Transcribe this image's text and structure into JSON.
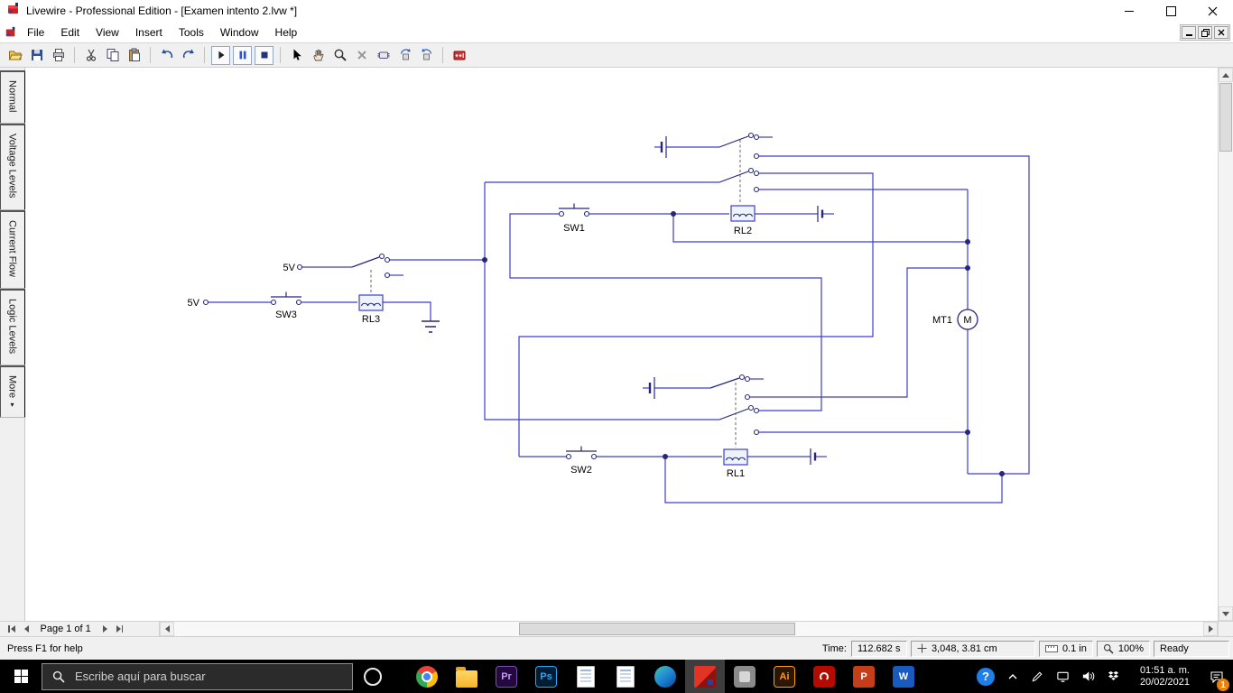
{
  "window": {
    "title": "Livewire - Professional Edition - [Examen intento 2.lvw *]",
    "controls": [
      "minimize",
      "maximize",
      "close"
    ]
  },
  "menubar": {
    "items": [
      {
        "label": "File",
        "name": "menu-file"
      },
      {
        "label": "Edit",
        "name": "menu-edit"
      },
      {
        "label": "View",
        "name": "menu-view"
      },
      {
        "label": "Insert",
        "name": "menu-insert"
      },
      {
        "label": "Tools",
        "name": "menu-tools"
      },
      {
        "label": "Window",
        "name": "menu-window"
      },
      {
        "label": "Help",
        "name": "menu-help"
      }
    ]
  },
  "toolbar": {
    "buttons": [
      "open-folder-icon",
      "save-floppy-icon",
      "print-icon",
      "cut-scissors-icon",
      "copy-icon",
      "paste-icon",
      "undo-icon",
      "redo-icon",
      "run-play-icon",
      "pause-icon",
      "stop-icon",
      "select-cursor-icon",
      "pan-hand-icon",
      "zoom-magnifier-icon",
      "delete-x-icon",
      "component-package-icon",
      "rotate-left-icon",
      "rotate-right-icon",
      "pcb-wizard-icon"
    ],
    "colors": {
      "run": "#222222",
      "pause": "#2a57c4",
      "stop": "#23327f",
      "pcb": "#cc3333"
    }
  },
  "sidebar": {
    "tabs": [
      {
        "label": "Normal",
        "name": "sidebar-tab-normal",
        "arrow": ""
      },
      {
        "label": "Voltage Levels",
        "name": "sidebar-tab-voltage-levels",
        "arrow": ""
      },
      {
        "label": "Current Flow",
        "name": "sidebar-tab-current-flow",
        "arrow": ""
      },
      {
        "label": "Logic Levels",
        "name": "sidebar-tab-logic-levels",
        "arrow": ""
      },
      {
        "label": "More",
        "name": "sidebar-tab-more",
        "arrow": "▾"
      }
    ]
  },
  "circuit": {
    "labels": {
      "sw1": "SW1",
      "sw2": "SW2",
      "sw3": "SW3",
      "rl1": "RL1",
      "rl2": "RL2",
      "rl3": "RL3",
      "mt1": "MT1",
      "motor": "M",
      "supply_a": "5V",
      "supply_b": "5V"
    },
    "wire_color": "#3d3dcc",
    "component_color": "#26267a"
  },
  "pager": {
    "page_label": "Page 1 of 1"
  },
  "statusbar": {
    "help": "Press F1 for help",
    "time_label": "Time:",
    "time_value": "112.682 s",
    "coordinates": "3,048, 3.81 cm",
    "grid_size": "0.1 in",
    "zoom": "100%",
    "state": "Ready",
    "icons": [
      "crosshair-icon",
      "ruler-icon",
      "magnifier-icon"
    ]
  },
  "taskbar": {
    "search_placeholder": "Escribe aquí para buscar",
    "apps": [
      {
        "name": "taskbar-chrome-icon",
        "cls": "ic-chrome",
        "wrap": "",
        "label": ""
      },
      {
        "name": "taskbar-file-explorer-icon",
        "cls": "ic-folder",
        "wrap": "",
        "label": ""
      },
      {
        "name": "taskbar-premiere-icon",
        "cls": "ic-pr",
        "wrap": "",
        "label": "Pr"
      },
      {
        "name": "taskbar-photoshop-icon",
        "cls": "ic-ps",
        "wrap": "",
        "label": "Ps"
      },
      {
        "name": "taskbar-document-icon",
        "cls": "ic-doc",
        "wrap": "",
        "label": ""
      },
      {
        "name": "taskbar-document-icon-2",
        "cls": "ic-doc",
        "wrap": "",
        "label": ""
      },
      {
        "name": "taskbar-edge-icon",
        "cls": "ic-edge",
        "wrap": "",
        "label": ""
      },
      {
        "name": "taskbar-livewire-icon",
        "cls": "ic-livewire",
        "wrap": "active",
        "label": ""
      },
      {
        "name": "taskbar-app-icon",
        "cls": "ic-generic",
        "wrap": "",
        "label": ""
      },
      {
        "name": "taskbar-illustrator-icon",
        "cls": "ic-ai",
        "wrap": "",
        "label": "Ai"
      },
      {
        "name": "taskbar-acrobat-icon",
        "cls": "ic-acrobat",
        "wrap": "",
        "label": ""
      },
      {
        "name": "taskbar-powerpoint-icon",
        "cls": "ic-ppt",
        "wrap": "",
        "label": "P"
      },
      {
        "name": "taskbar-word-icon",
        "cls": "ic-word",
        "wrap": "",
        "label": "W"
      }
    ],
    "tray": {
      "help_glyph": "?",
      "icons": [
        "help-icon",
        "chevron-up-icon",
        "pen-icon",
        "network-icon",
        "volume-icon",
        "dropbox-icon",
        "action-center-icon"
      ]
    },
    "clock": {
      "time": "01:51 a. m.",
      "date": "20/02/2021"
    },
    "badge": "1"
  }
}
